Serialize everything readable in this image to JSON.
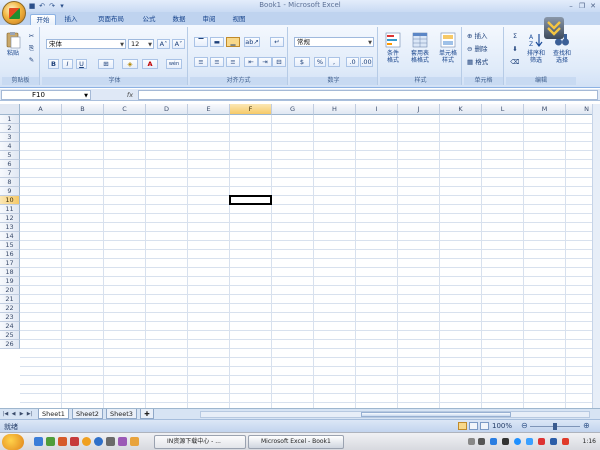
{
  "window": {
    "title": "Book1 - Microsoft Excel",
    "minimize": "–",
    "restore": "❐",
    "close": "✕"
  },
  "quick_access": {
    "save": "■",
    "undo": "↶",
    "redo": "↷",
    "more": "▾"
  },
  "tabs": [
    "开始",
    "插入",
    "页面布局",
    "公式",
    "数据",
    "审阅",
    "视图"
  ],
  "active_tab": "开始",
  "ribbon": {
    "clipboard": {
      "paste_label": "粘贴",
      "group_label": "剪贴板"
    },
    "font": {
      "name": "宋体",
      "size": "12",
      "group_label": "字体",
      "bold": "B",
      "italic": "I",
      "underline": "U",
      "grow": "A˄",
      "shrink": "A˅",
      "borders": "⊞",
      "fill": "◈",
      "color": "A",
      "misc": "wén"
    },
    "alignment": {
      "group_label": "对齐方式"
    },
    "number": {
      "format": "常规",
      "group_label": "数字",
      "percent": "%",
      "comma": ",",
      "currency": "$"
    },
    "styles": {
      "conditional": "条件\n格式",
      "table": "套用表\n格格式",
      "cell": "单元格\n样式",
      "group_label": "样式"
    },
    "cells": {
      "insert": "插入",
      "delete": "删除",
      "format": "格式",
      "group_label": "单元格"
    },
    "editing": {
      "sum": "Σ",
      "sort": "排序和\n筛选",
      "find": "查找和\n选择",
      "group_label": "编辑"
    }
  },
  "formula_bar": {
    "name_box": "F10",
    "fx": "fx",
    "content": ""
  },
  "columns": [
    "A",
    "B",
    "C",
    "D",
    "E",
    "F",
    "G",
    "H",
    "I",
    "J",
    "K",
    "L",
    "M",
    "N"
  ],
  "rows": [
    "1",
    "2",
    "3",
    "4",
    "5",
    "6",
    "7",
    "8",
    "9",
    "10",
    "11",
    "12",
    "13",
    "14",
    "15",
    "16",
    "17",
    "18",
    "19",
    "20",
    "21",
    "22",
    "23",
    "24",
    "25",
    "26"
  ],
  "selected_cell": {
    "column": "F",
    "row": "10"
  },
  "sheets": [
    "Sheet1",
    "Sheet2",
    "Sheet3"
  ],
  "active_sheet": "Sheet1",
  "status": {
    "text": "就绪",
    "zoom": "100%"
  },
  "taskbar": {
    "tasks": [
      "IN资源下载中心 - ...",
      "Microsoft Excel - Book1"
    ],
    "active_task": 1,
    "clock": "1:16"
  }
}
